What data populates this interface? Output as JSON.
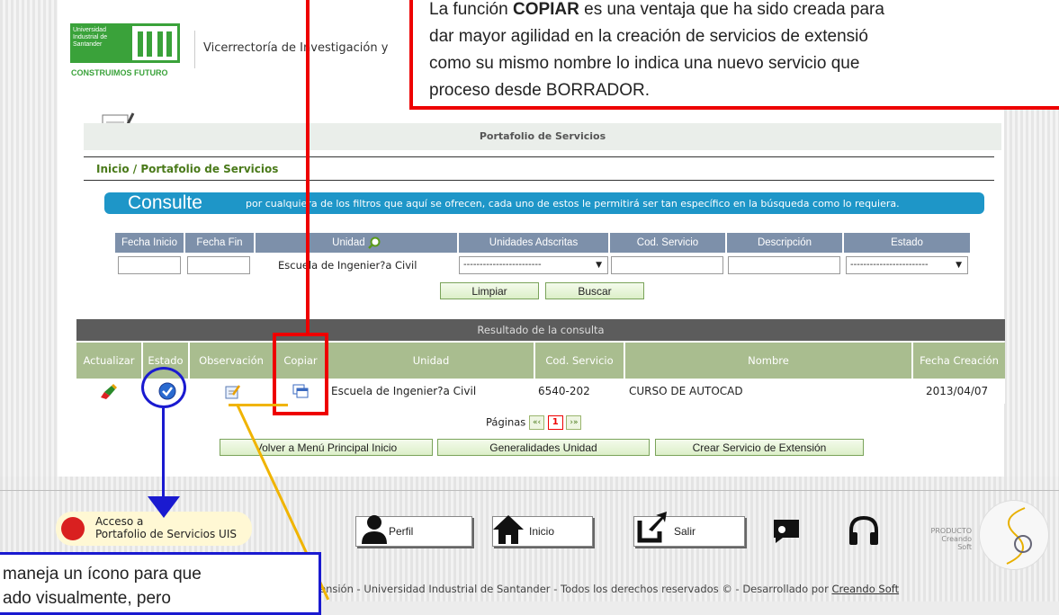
{
  "header": {
    "logo_text": "Universidad Industrial de Santander",
    "logo_tagline": "CONSTRUIMOS FUTURO",
    "title": "Vicerrectoría de Investigación y"
  },
  "callout_red": {
    "line1_pre": "La función ",
    "line1_bold": "COPIAR",
    "line1_post": " es una ventaja que ha sido creada para",
    "line2": "dar mayor agilidad en la creación de servicios de extensió",
    "line3": "como su mismo nombre lo indica una nuevo servicio que",
    "line4": "proceso desde BORRADOR."
  },
  "band_title": "Portafolio de Servicios",
  "breadcrumb": "Inicio / Portafolio de Servicios",
  "consulte": {
    "big": "Consulte",
    "rest": "por cualquiera de los filtros que aquí se ofrecen, cada uno de estos le permitirá ser tan específico en la búsqueda como lo requiera."
  },
  "filters": {
    "headers": [
      "Fecha Inicio",
      "Fecha Fin",
      "Unidad",
      "Unidades Adscritas",
      "Cod. Servicio",
      "Descripción",
      "Estado"
    ],
    "unidad_value": "Escuela de Ingenier?a Civil",
    "adscritas_value": "------------------------",
    "estado_value": "------------------------"
  },
  "buttons": {
    "limpiar": "Limpiar",
    "buscar": "Buscar",
    "volver": "Volver a Menú Principal Inicio",
    "generalidades": "Generalidades Unidad",
    "crear": "Crear Servicio de Extensión"
  },
  "results": {
    "title": "Resultado de la consulta",
    "headers": [
      "Actualizar",
      "Estado",
      "Observación",
      "Copiar",
      "Unidad",
      "Cod. Servicio",
      "Nombre",
      "Fecha Creación"
    ],
    "row": {
      "unidad": "Escuela de Ingenier?a Civil",
      "cod": "6540-202",
      "nombre": "CURSO DE AUTOCAD",
      "fecha": "2013/04/07"
    }
  },
  "pagination": {
    "label": "Páginas",
    "first": "«‹",
    "current": "1",
    "last": "›»"
  },
  "footer": {
    "acceso_line1": "Acceso a",
    "acceso_line2": "Portafolio de Servicios UIS",
    "perfil": "Perfil",
    "inicio": "Inicio",
    "salir": "Salir",
    "producto_line1": "PRODUCTO",
    "producto_line2": "Creando Soft",
    "copyright": "ensión - Universidad Industrial de Santander - Todos los derechos reservados © - Desarrollado por ",
    "copyright_link": "Creando Soft"
  },
  "callout_blue": {
    "line1": "maneja un ícono para que",
    "line2": "ado visualmente, pero"
  },
  "colors": {
    "red": "#e00000",
    "blue": "#1a1ad0",
    "yellow": "#f0b400",
    "green": "#3aa23a",
    "consulte": "#1e96c8"
  }
}
